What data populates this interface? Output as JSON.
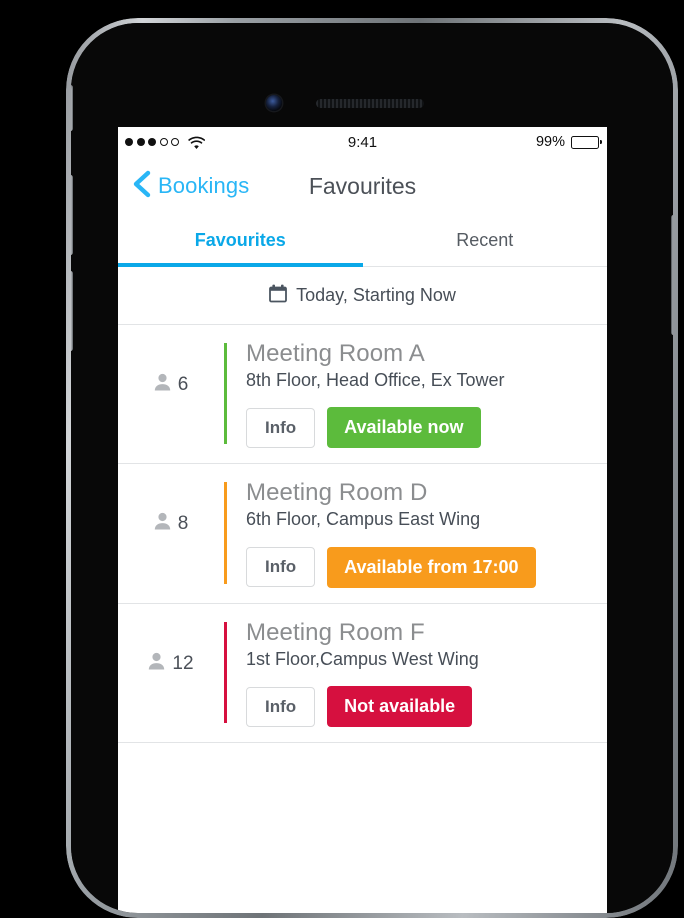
{
  "status_bar": {
    "signal_filled": 3,
    "signal_empty": 2,
    "wifi_icon": "wifi-icon",
    "time": "9:41",
    "battery_percent": "99%",
    "battery_fill": 52
  },
  "nav": {
    "back_icon": "chevron-left-icon",
    "back_label": "Bookings",
    "title": "Favourites"
  },
  "tabs": [
    {
      "label": "Favourites",
      "active": true
    },
    {
      "label": "Recent",
      "active": false
    }
  ],
  "filter": {
    "icon": "calendar-icon",
    "label": "Today, Starting Now"
  },
  "colors": {
    "accent_blue": "#0aa8e8",
    "link_blue": "#29b6f6",
    "available": "#5cbb3c",
    "soon": "#f89b1c",
    "unavailable": "#d6103f"
  },
  "rooms": [
    {
      "capacity": "6",
      "capacity_icon": "person-icon",
      "name": "Meeting Room A",
      "location": "8th Floor, Head Office, Ex Tower",
      "info_label": "Info",
      "status_label": "Available now",
      "status_color": "#5cbb3c",
      "accent_color": "#5cbb3c"
    },
    {
      "capacity": "8",
      "capacity_icon": "person-icon",
      "name": "Meeting Room D",
      "location": "6th Floor, Campus East Wing",
      "info_label": "Info",
      "status_label": "Available from 17:00",
      "status_color": "#f89b1c",
      "accent_color": "#f89b1c"
    },
    {
      "capacity": "12",
      "capacity_icon": "person-icon",
      "name": "Meeting Room F",
      "location": "1st Floor,Campus West Wing",
      "info_label": "Info",
      "status_label": "Not available",
      "status_color": "#d6103f",
      "accent_color": "#d6103f"
    }
  ]
}
